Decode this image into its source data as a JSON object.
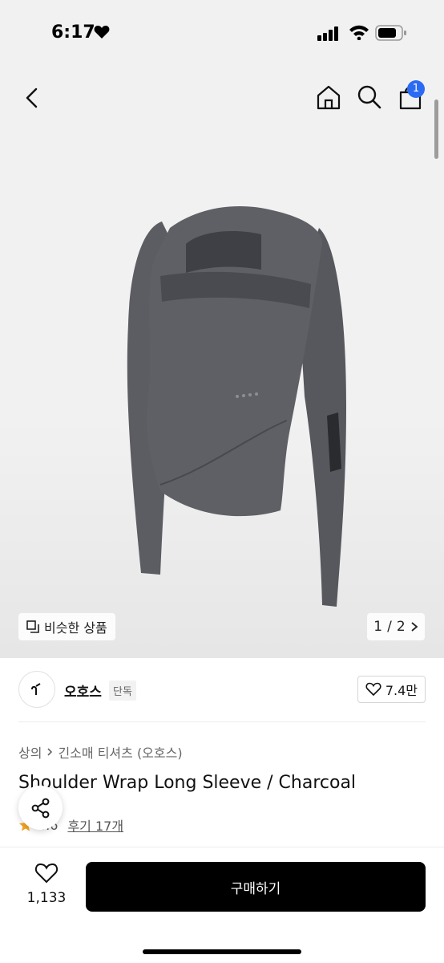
{
  "status_bar": {
    "time": "6:17"
  },
  "header": {
    "cart_count": "1"
  },
  "gallery": {
    "similar_label": "비슷한 상품",
    "page_current": "1",
    "page_total": "2",
    "page_separator": "/"
  },
  "brand": {
    "name": "오호스",
    "tag": "단독",
    "likes": "7.4만"
  },
  "breadcrumb": {
    "category": "상의",
    "subcategory": "긴소매 티셔츠 (오호스)"
  },
  "product": {
    "title": "Shoulder Wrap Long Sleeve / Charcoal",
    "rating": "4.6",
    "reviews": "후기 17개"
  },
  "bottom": {
    "wish_count": "1,133",
    "buy_label": "구매하기"
  },
  "colors": {
    "accent": "#2b6bf3",
    "garment": "#55565b",
    "buy": "#000000"
  }
}
